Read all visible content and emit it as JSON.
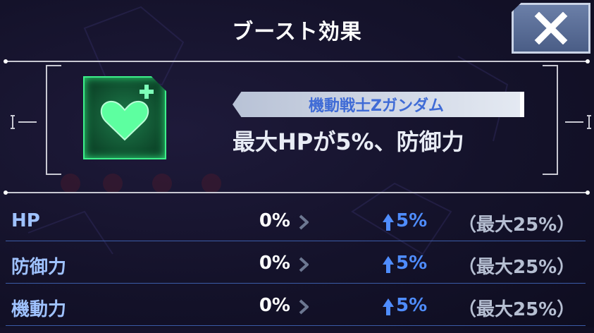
{
  "header": {
    "title": "ブースト効果",
    "close_icon": "close-icon"
  },
  "boost": {
    "icon": "heart-plus-icon",
    "source_name": "機動戦士Zガンダム",
    "effect_text": "最大HPが5%、防御力"
  },
  "stats": [
    {
      "label": "HP",
      "current": "0%",
      "new": "5%",
      "max": "（最大25%）"
    },
    {
      "label": "防御力",
      "current": "0%",
      "new": "5%",
      "max": "（最大25%）"
    },
    {
      "label": "機動力",
      "current": "0%",
      "new": "5%",
      "max": "（最大25%）"
    }
  ],
  "colors": {
    "accent_blue": "#4f8dff",
    "label_blue": "#9fc2ff",
    "icon_green": "#3df08a",
    "ribbon_text": "#3f6bd6"
  }
}
